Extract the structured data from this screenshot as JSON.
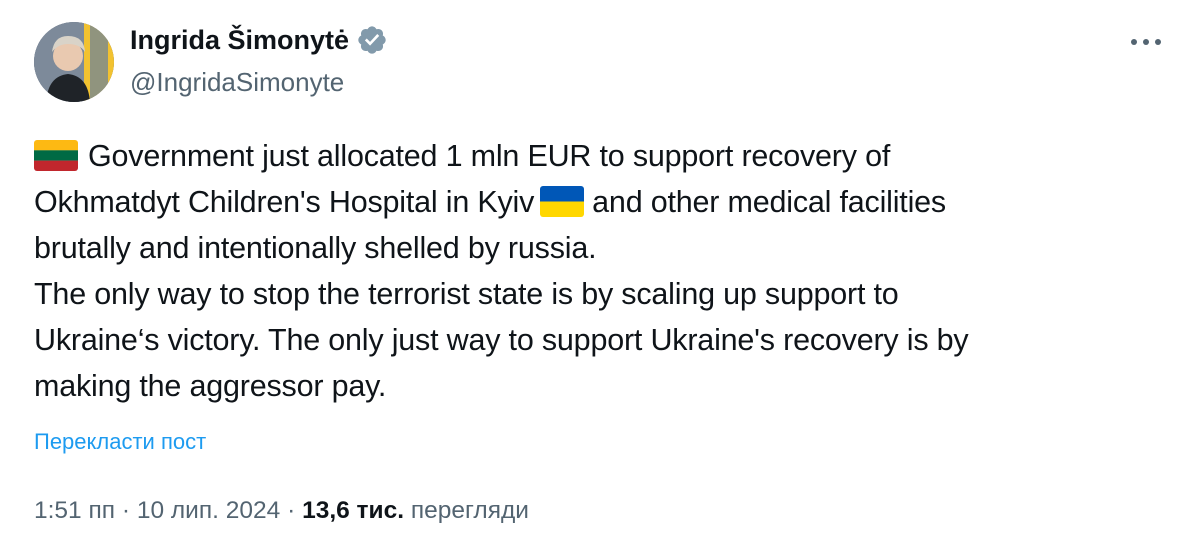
{
  "author": {
    "name": "Ingrida Šimonytė",
    "handle": "@IngridaSimonyte",
    "verified": true,
    "avatar": "avatar-photo"
  },
  "tweet": {
    "lines": [
      {
        "flag_before": "lithuania-flag-icon",
        "text": "Government just allocated 1 mln EUR to support recovery of"
      },
      {
        "text_before": "Okhmatdyt Children's Hospital in Kyiv",
        "flag": "ukraine-flag-icon",
        "text_after": "and other medical facilities"
      },
      {
        "text": "brutally and intentionally shelled by russia."
      },
      {
        "text": "The only way to stop the terrorist state is by scaling up support to"
      },
      {
        "text": "Ukraine‘s victory. The only just way to support Ukraine's recovery is by"
      },
      {
        "text": "making the aggressor pay."
      }
    ]
  },
  "translate_label": "Перекласти пост",
  "meta": {
    "time": "1:51 пп",
    "separator": "·",
    "date": "10 лип. 2024",
    "views_count": "13,6 тис.",
    "views_label": "перегляди"
  },
  "colors": {
    "text": "#0f1419",
    "secondary": "#536471",
    "link": "#1d9bf0",
    "verified_badge": "#829aab"
  },
  "icons": {
    "verified": "verified-badge-icon",
    "more": "more-options-icon"
  }
}
